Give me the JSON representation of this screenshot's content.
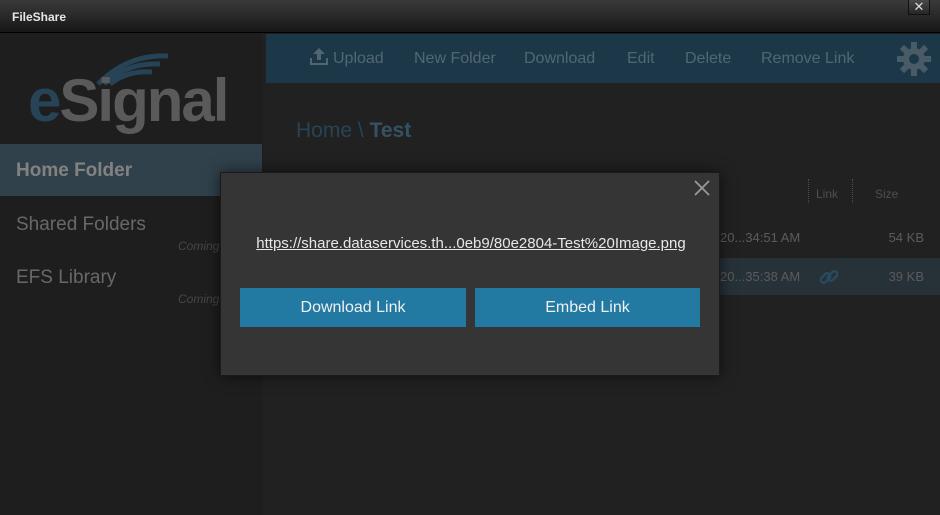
{
  "window": {
    "title": "FileShare",
    "close_glyph": "✕"
  },
  "logo": {
    "brand_e": "e",
    "brand_rest": "Signal"
  },
  "sidebar": {
    "items": [
      {
        "label": "Home Folder",
        "active": true,
        "note": ""
      },
      {
        "label": "Shared Folders",
        "active": false,
        "note": "Coming"
      },
      {
        "label": "EFS Library",
        "active": false,
        "note": "Coming"
      }
    ]
  },
  "toolbar": {
    "upload": "Upload",
    "new_folder": "New Folder",
    "download": "Download",
    "edit": "Edit",
    "delete": "Delete",
    "remove_link": "Remove Link",
    "settings_icon": "gear-icon"
  },
  "breadcrumb": {
    "root": "Home",
    "separator": "\\",
    "current": "Test"
  },
  "table": {
    "columns": {
      "link": "Link",
      "size": "Size"
    },
    "rows": [
      {
        "date": "20...34:51 AM",
        "size": "54 KB",
        "linked": false
      },
      {
        "date": "20...35:38 AM",
        "size": "39 KB",
        "linked": true
      }
    ]
  },
  "modal": {
    "url": "https://share.dataservices.th...0eb9/80e2804-Test%20Image.png",
    "download_link": "Download Link",
    "embed_link": "Embed Link"
  },
  "colors": {
    "toolbar": "#2c566f",
    "active_nav": "#4a6474",
    "button": "#227aa3"
  }
}
